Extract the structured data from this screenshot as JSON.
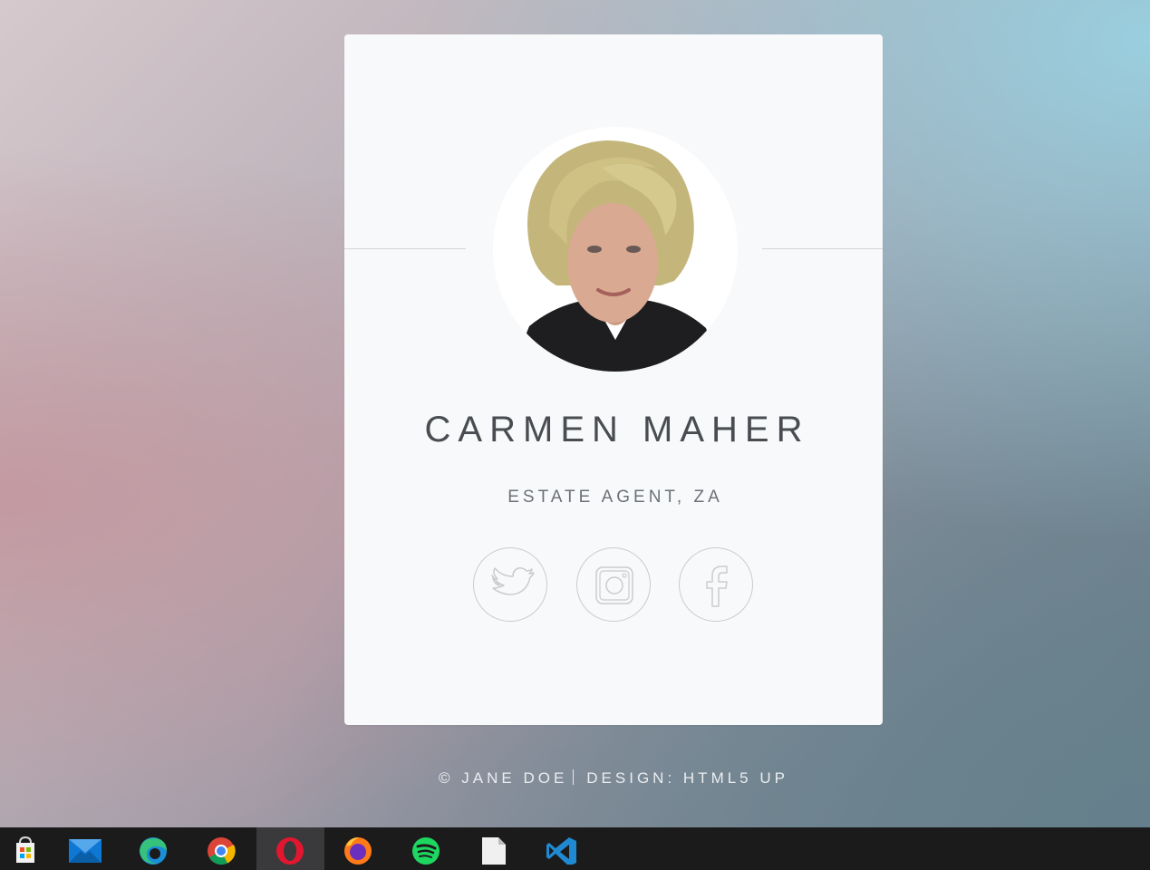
{
  "profile": {
    "name": "CARMEN MAHER",
    "role": "ESTATE AGENT, ZA"
  },
  "social": [
    {
      "icon": "twitter-icon",
      "label": "Twitter"
    },
    {
      "icon": "instagram-icon",
      "label": "Instagram"
    },
    {
      "icon": "facebook-icon",
      "label": "Facebook"
    }
  ],
  "footer": {
    "copyright": "© JANE DOE",
    "design": "DESIGN: HTML5 UP"
  },
  "taskbar": {
    "apps": [
      {
        "name": "Microsoft Store",
        "icon": "store-icon"
      },
      {
        "name": "Mail",
        "icon": "mail-icon"
      },
      {
        "name": "Microsoft Edge",
        "icon": "edge-icon"
      },
      {
        "name": "Google Chrome",
        "icon": "chrome-icon"
      },
      {
        "name": "Opera",
        "icon": "opera-icon",
        "active": true
      },
      {
        "name": "Firefox",
        "icon": "firefox-icon"
      },
      {
        "name": "Spotify",
        "icon": "spotify-icon"
      },
      {
        "name": "File",
        "icon": "file-icon"
      },
      {
        "name": "Visual Studio Code",
        "icon": "vscode-icon"
      }
    ]
  },
  "colors": {
    "card_bg": "#f8f9fa",
    "name_text": "#494d52",
    "role_text": "#6c7178",
    "icon_stroke": "#c9cccf",
    "taskbar_bg": "#1b1b1c"
  }
}
